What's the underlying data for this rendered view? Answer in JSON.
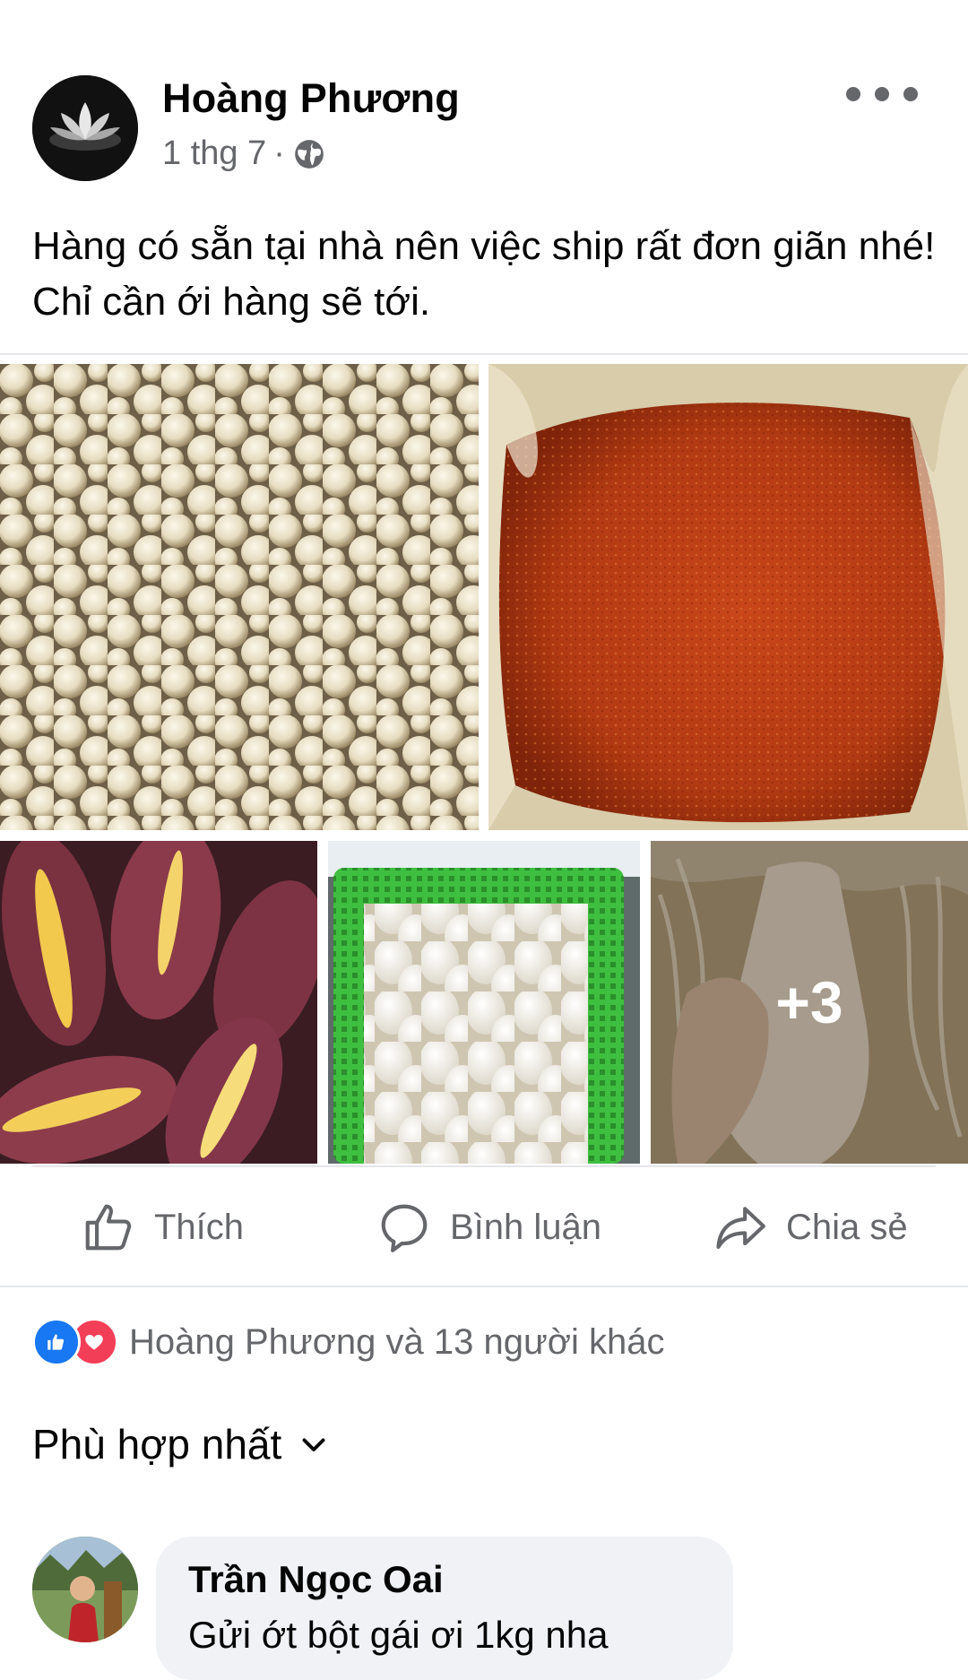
{
  "post": {
    "author": "Hoàng Phương",
    "date": "1 thg 7",
    "dot": "·",
    "text": "Hàng có sẵn tại nhà nên việc ship rất đơn giãn nhé! Chỉ cần ới hàng sẽ tới.",
    "more_photos_label": "+3"
  },
  "photos": [
    {
      "subject": "small white onions"
    },
    {
      "subject": "red chili powder in plastic bag"
    },
    {
      "subject": "purple sweet potatoes"
    },
    {
      "subject": "eggs in green basket"
    },
    {
      "subject": "dried squid"
    }
  ],
  "actions": {
    "like": "Thích",
    "comment": "Bình luận",
    "share": "Chia sẻ"
  },
  "reactions": {
    "summary": "Hoàng Phương và 13 người khác"
  },
  "sort": {
    "label": "Phù hợp nhất"
  },
  "comment": {
    "author": "Trần Ngọc Oai",
    "text": "Gửi ớt bột gái ơi     1kg nha"
  },
  "colors": {
    "secondary_text": "#65676b",
    "like_blue": "#1877f2",
    "love_red": "#f33e58",
    "bubble_bg": "#f0f2f5",
    "separator": "#e4e6eb"
  }
}
